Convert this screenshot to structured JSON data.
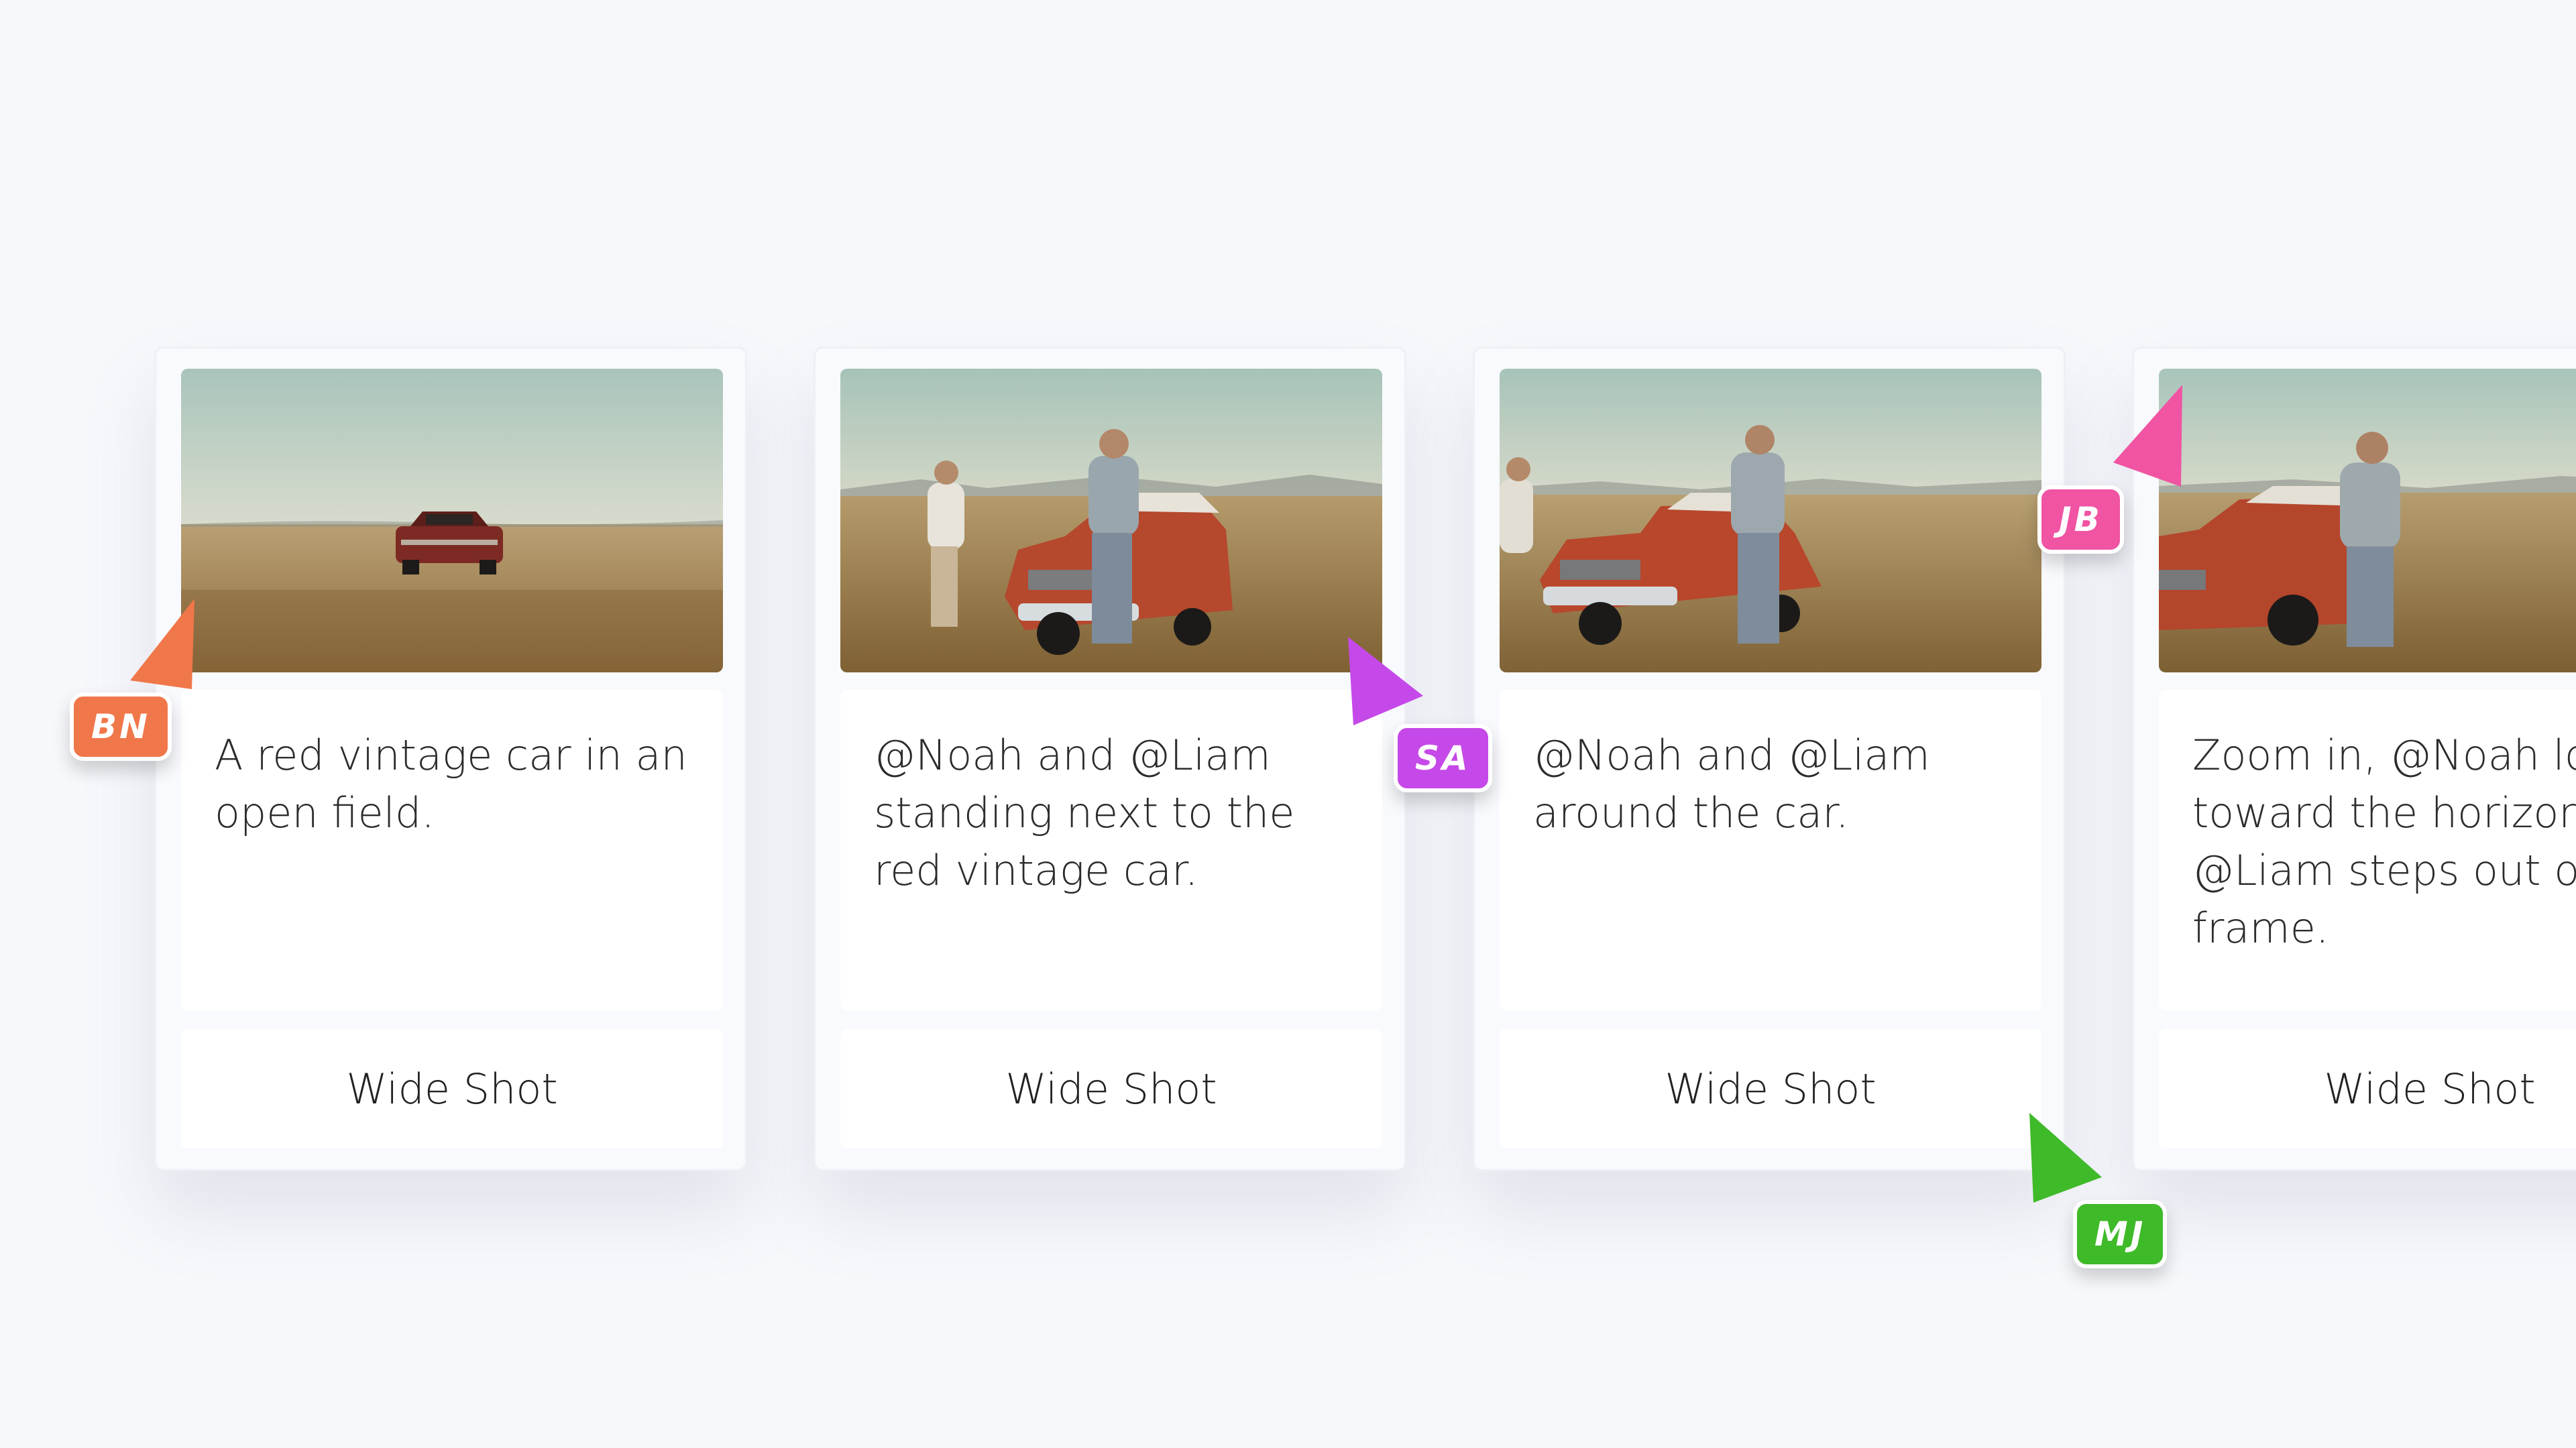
{
  "cards": [
    {
      "description": "A red vintage car in an open field.",
      "shot_type": "Wide Shot",
      "thumbnail": "red-vintage-car-in-field"
    },
    {
      "description": "@Noah and @Liam standing next to the red vintage car.",
      "shot_type": "Wide Shot",
      "thumbnail": "two-men-beside-red-car"
    },
    {
      "description": "@Noah and @Liam around the car.",
      "shot_type": "Wide Shot",
      "thumbnail": "two-men-around-red-car"
    },
    {
      "description": "Zoom in, @Noah looks toward the horizon as @Liam steps out of frame.",
      "shot_type": "Wide Shot",
      "thumbnail": "man-at-red-car-looking-away"
    }
  ],
  "collaborators": [
    {
      "initials": "BN",
      "color": "#f0774a",
      "icon": "cursor-arrow-icon"
    },
    {
      "initials": "SA",
      "color": "#c549e8",
      "icon": "cursor-arrow-icon"
    },
    {
      "initials": "JB",
      "color": "#f054a3",
      "icon": "cursor-arrow-icon"
    },
    {
      "initials": "MJ",
      "color": "#3fba29",
      "icon": "cursor-arrow-icon"
    }
  ]
}
